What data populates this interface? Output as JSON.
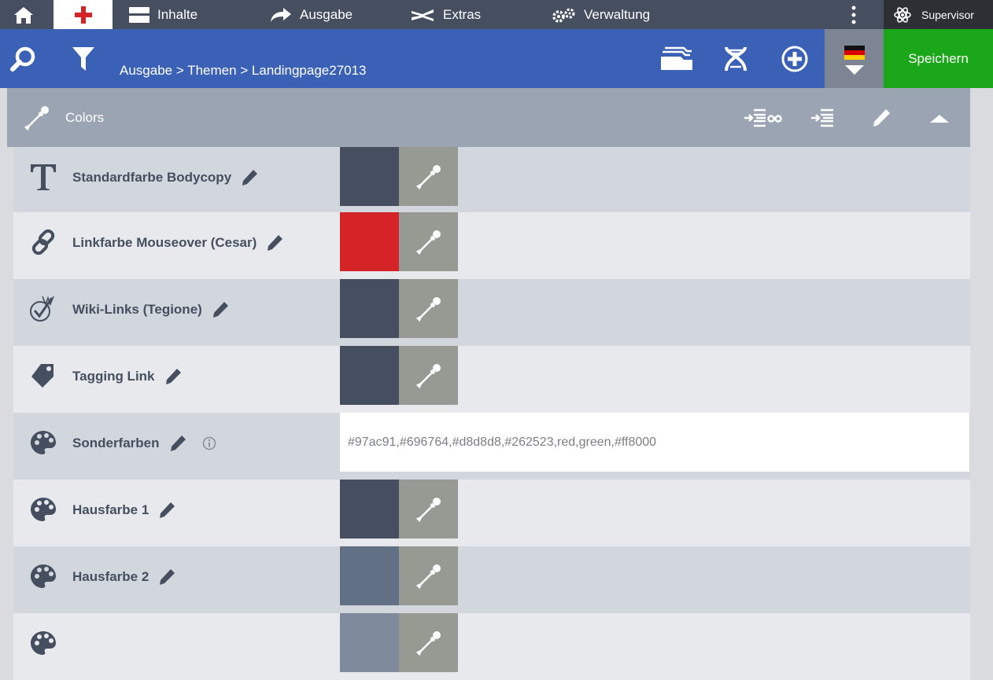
{
  "nav": {
    "items": [
      {
        "label": "Inhalte",
        "icon": "content-icon"
      },
      {
        "label": "Ausgabe",
        "icon": "share-arrow-icon"
      },
      {
        "label": "Extras",
        "icon": "extras-icon"
      },
      {
        "label": "Verwaltung",
        "icon": "gears-icon"
      }
    ],
    "user": "Supervisor"
  },
  "toolbar": {
    "breadcrumb": "Ausgabe > Themen > Landingpage27013",
    "save_label": "Speichern"
  },
  "section": {
    "title": "Colors"
  },
  "rows": [
    {
      "label": "Standardfarbe Bodycopy",
      "icon": "text-T-icon",
      "color": "#454f5f"
    },
    {
      "label": "Linkfarbe Mouseover (Cesar)",
      "icon": "link-icon",
      "color": "#d42427"
    },
    {
      "label": "Wiki-Links (Tegione)",
      "icon": "wiki-check-icon",
      "color": "#454f5f"
    },
    {
      "label": "Tagging Link",
      "icon": "tag-icon",
      "color": "#454f5f"
    },
    {
      "label": "Sonderfarben",
      "icon": "palette-icon",
      "value": "#97ac91,#696764,#d8d8d8,#262523,red,green,#ff8000"
    },
    {
      "label": "Hausfarbe 1",
      "icon": "palette-icon",
      "color": "#454f5f"
    },
    {
      "label": "Hausfarbe 2",
      "icon": "palette-icon",
      "color": "#627086"
    },
    {
      "label": "",
      "icon": "palette-icon",
      "color": "#7f8a9c"
    }
  ],
  "colors": {
    "topnav": "#454f5f",
    "toolbar": "#3a61b5",
    "save": "#1aa81a",
    "section_header": "#9aa4b2",
    "picker": "#969a92",
    "accent_red": "#d42427"
  }
}
